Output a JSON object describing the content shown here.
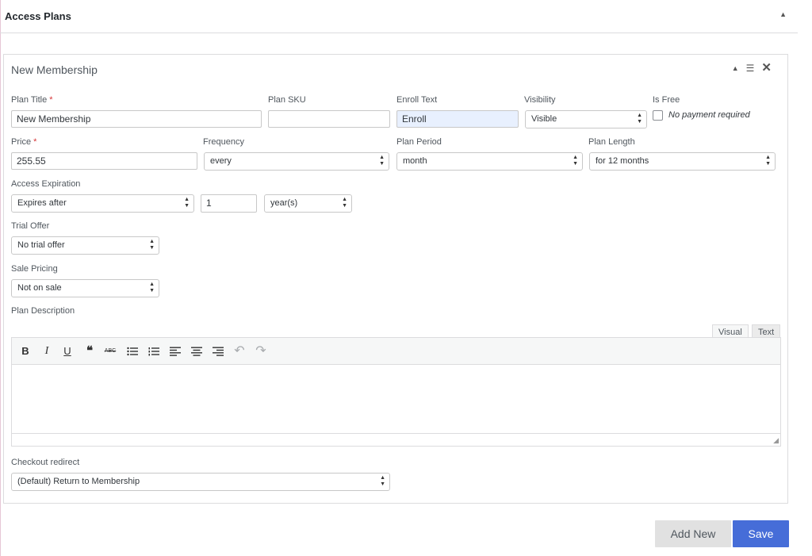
{
  "section": {
    "title": "Access Plans",
    "toggle_icon": "▲"
  },
  "plan": {
    "title": "New Membership",
    "tools": {
      "collapse": "▲",
      "drag": "☰",
      "close": "✕"
    },
    "fields": {
      "plan_title": {
        "label": "Plan Title",
        "required": "*",
        "value": "New Membership"
      },
      "plan_sku": {
        "label": "Plan SKU",
        "value": ""
      },
      "enroll_text": {
        "label": "Enroll Text",
        "value": "Enroll"
      },
      "visibility": {
        "label": "Visibility",
        "value": "Visible"
      },
      "is_free": {
        "label": "Is Free",
        "checkbox_label": "No payment required",
        "checked": false
      },
      "price": {
        "label": "Price",
        "required": "*",
        "value": "255.55"
      },
      "frequency": {
        "label": "Frequency",
        "value": "every"
      },
      "plan_period": {
        "label": "Plan Period",
        "value": "month"
      },
      "plan_length": {
        "label": "Plan Length",
        "value": "for 12 months"
      },
      "access_expiration": {
        "label": "Access Expiration",
        "type_value": "Expires after",
        "length_value": "1",
        "period_value": "year(s)"
      },
      "trial_offer": {
        "label": "Trial Offer",
        "value": "No trial offer"
      },
      "sale_pricing": {
        "label": "Sale Pricing",
        "value": "Not on sale"
      },
      "plan_description": {
        "label": "Plan Description"
      },
      "checkout_redirect": {
        "label": "Checkout redirect",
        "value": "(Default) Return to Membership"
      }
    },
    "editor": {
      "tab_visual": "Visual",
      "tab_text": "Text",
      "toolbar": {
        "bold": "B",
        "italic": "I",
        "underline": "U",
        "blockquote": "❝",
        "strikethrough": "ABC",
        "undo": "↶",
        "redo": "↷"
      }
    }
  },
  "buttons": {
    "add_new": "Add New",
    "save": "Save"
  },
  "colors": {
    "save_button": "#466dd8",
    "add_new_button": "#e1e1e1",
    "required": "#d63638",
    "enroll_highlight": "#e8f0fe"
  }
}
